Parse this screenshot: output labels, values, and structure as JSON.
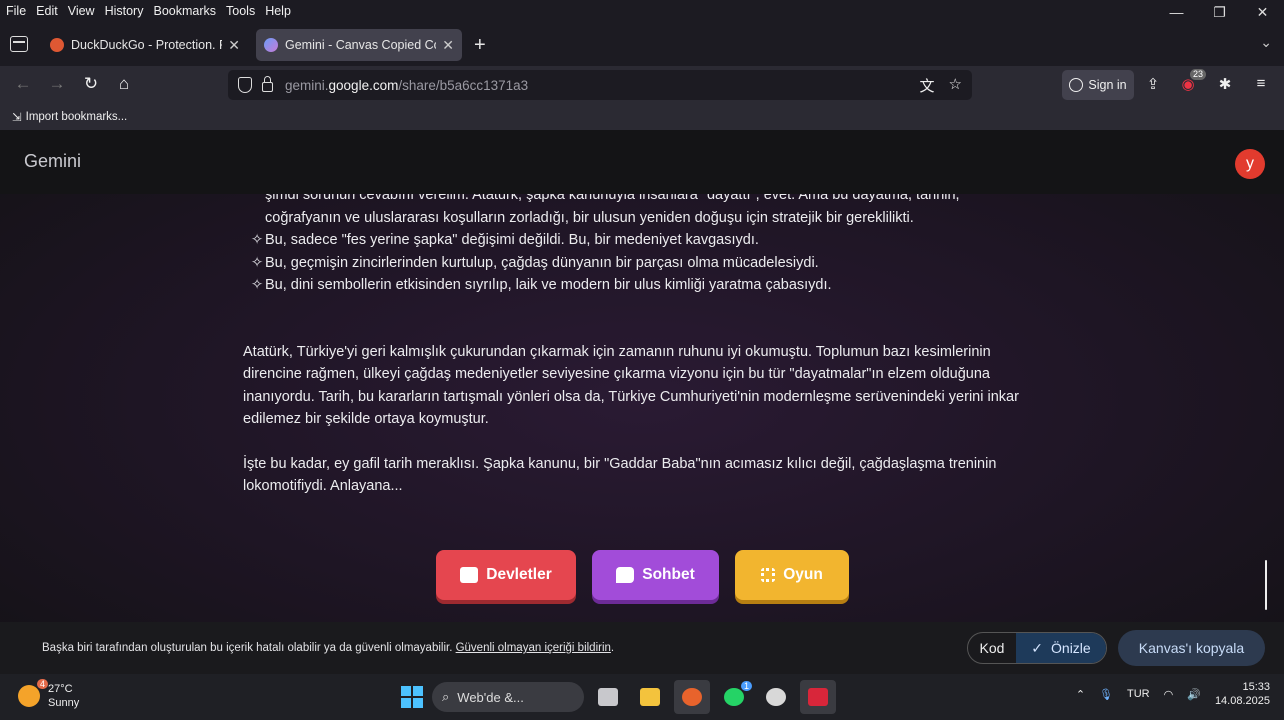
{
  "menubar": {
    "items": [
      "File",
      "Edit",
      "View",
      "History",
      "Bookmarks",
      "Tools",
      "Help"
    ]
  },
  "tabs": [
    {
      "title": "DuckDuckGo - Protection. Priva",
      "favicon_color": "#de5833"
    },
    {
      "title": "Gemini - Canvas Copied Confirm",
      "favicon_color": "#6b9cf7"
    }
  ],
  "urlbar": {
    "prefix": "gemini.",
    "host": "google.com",
    "path": "/share/b5a6cc1371a3"
  },
  "toolbar": {
    "signin_label": "Sign in",
    "extension_badge": "23"
  },
  "bookmarks": {
    "import_label": "Import bookmarks..."
  },
  "gemini": {
    "logo": "Gemini",
    "avatar_letter": "y"
  },
  "article": {
    "partial_line": "şimdi sorunun cevabını verelim. Atatürk, şapka kanunuyla insanlara \"dayattı\", evet. Ama bu dayatma, tarihin,",
    "continued_line": "coğrafyanın ve uluslararası koşulların zorladığı, bir ulusun yeniden doğuşu için stratejik bir gereklilikti.",
    "bullet_mark": "✧",
    "bullets": [
      "Bu, sadece \"fes yerine şapka\" değişimi değildi. Bu, bir medeniyet kavgasıydı.",
      "Bu, geçmişin zincirlerinden kurtulup, çağdaş dünyanın bir parçası olma mücadelesiydi.",
      "Bu, dini sembollerin etkisinden sıyrılıp, laik ve modern bir ulus kimliği yaratma çabasıydı."
    ],
    "paragraph1": "Atatürk, Türkiye'yi geri kalmışlık çukurundan çıkarmak için zamanın ruhunu iyi okumuştu. Toplumun bazı kesimlerinin direncine rağmen, ülkeyi çağdaş medeniyetler seviyesine çıkarma vizyonu için bu tür \"dayatmalar\"ın elzem olduğuna inanıyordu. Tarih, bu kararların tartışmalı yönleri olsa da, Türkiye Cumhuriyeti'nin modernleşme serüvenindeki yerini inkar edilemez bir şekilde ortaya koymuştur.",
    "paragraph2": "İşte bu kadar, ey gafil tarih meraklısı. Şapka kanunu, bir \"Gaddar Baba\"nın acımasız kılıcı değil, çağdaşlaşma treninin lokomotifiydi. Anlayana..."
  },
  "actions": [
    {
      "label": "Devletler",
      "color": "#e5464f"
    },
    {
      "label": "Sohbet",
      "color": "#a24cd9"
    },
    {
      "label": "Oyun",
      "color": "#f2b52f"
    }
  ],
  "bottombar": {
    "disclaimer": "Başka biri tarafından oluşturulan bu içerik hatalı olabilir ya da güvenli olmayabilir.",
    "report_link": "Güvenli olmayan içeriği bildirin",
    "period": ".",
    "code_label": "Kod",
    "preview_label": "Önizle",
    "copy_label": "Kanvas'ı kopyala"
  },
  "taskbar": {
    "weather_badge": "4",
    "temperature": "27°C",
    "condition": "Sunny",
    "search_placeholder": "Web'de &...",
    "whatsapp_badge": "1",
    "language": "TUR",
    "time": "15:33",
    "date": "14.08.2025"
  }
}
